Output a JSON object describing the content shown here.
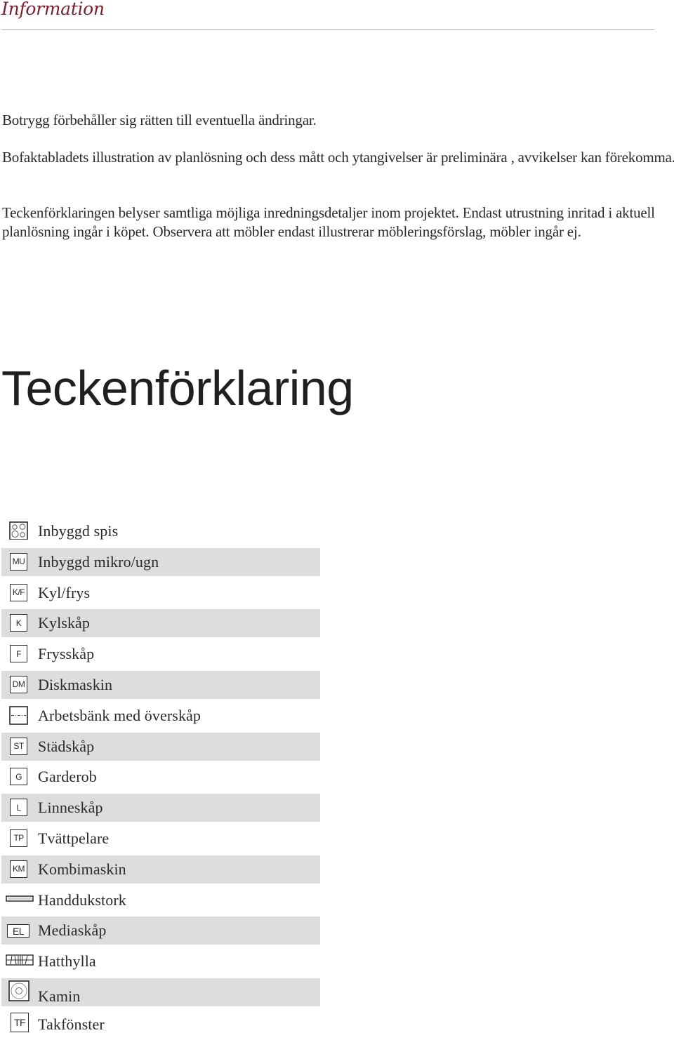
{
  "header": {
    "title": "Information",
    "accent_color": "#7a1f2b"
  },
  "paragraphs": [
    "Botrygg förbehåller sig rätten till eventuella ändringar.",
    "Bofaktabladets illustration av planlösning och dess mått och ytangivelser är preliminära , avvikelser kan förekomma.",
    "Teckenförklaringen belyser samtliga möjliga inredningsdetaljer inom projektet. Endast utrustning inritad i aktuell planlösning ingår i köpet. Observera att möbler endast illustrerar möbleringsförslag, möbler ingår ej."
  ],
  "legend": {
    "title": "Teckenförklaring",
    "items": [
      {
        "icon": "stove-icon",
        "code": "",
        "label": "Inbyggd spis"
      },
      {
        "icon": "microwave-oven-icon",
        "code": "MU",
        "label": "Inbyggd mikro/ugn"
      },
      {
        "icon": "fridge-freezer-icon",
        "code": "K/F",
        "label": "Kyl/frys"
      },
      {
        "icon": "fridge-icon",
        "code": "K",
        "label": "Kylskåp"
      },
      {
        "icon": "freezer-icon",
        "code": "F",
        "label": "Frysskåp"
      },
      {
        "icon": "dishwasher-icon",
        "code": "DM",
        "label": "Diskmaskin"
      },
      {
        "icon": "counter-upper-cabinet-icon",
        "code": "",
        "label": "Arbetsbänk med överskåp"
      },
      {
        "icon": "cleaning-cabinet-icon",
        "code": "ST",
        "label": "Städskåp"
      },
      {
        "icon": "wardrobe-icon",
        "code": "G",
        "label": "Garderob"
      },
      {
        "icon": "linen-cabinet-icon",
        "code": "L",
        "label": "Linneskåp"
      },
      {
        "icon": "washer-dryer-stack-icon",
        "code": "TP",
        "label": "Tvättpelare"
      },
      {
        "icon": "combi-machine-icon",
        "code": "KM",
        "label": "Kombimaskin"
      },
      {
        "icon": "towel-dryer-icon",
        "code": "",
        "label": "Handdukstork"
      },
      {
        "icon": "media-cabinet-icon",
        "code": "EL",
        "label": "Mediaskåp"
      },
      {
        "icon": "hat-shelf-icon",
        "code": "",
        "label": "Hatthylla"
      },
      {
        "icon": "fireplace-icon",
        "code": "",
        "label": "Kamin"
      },
      {
        "icon": "skylight-icon",
        "code": "TF",
        "label": "Takfönster"
      }
    ]
  }
}
